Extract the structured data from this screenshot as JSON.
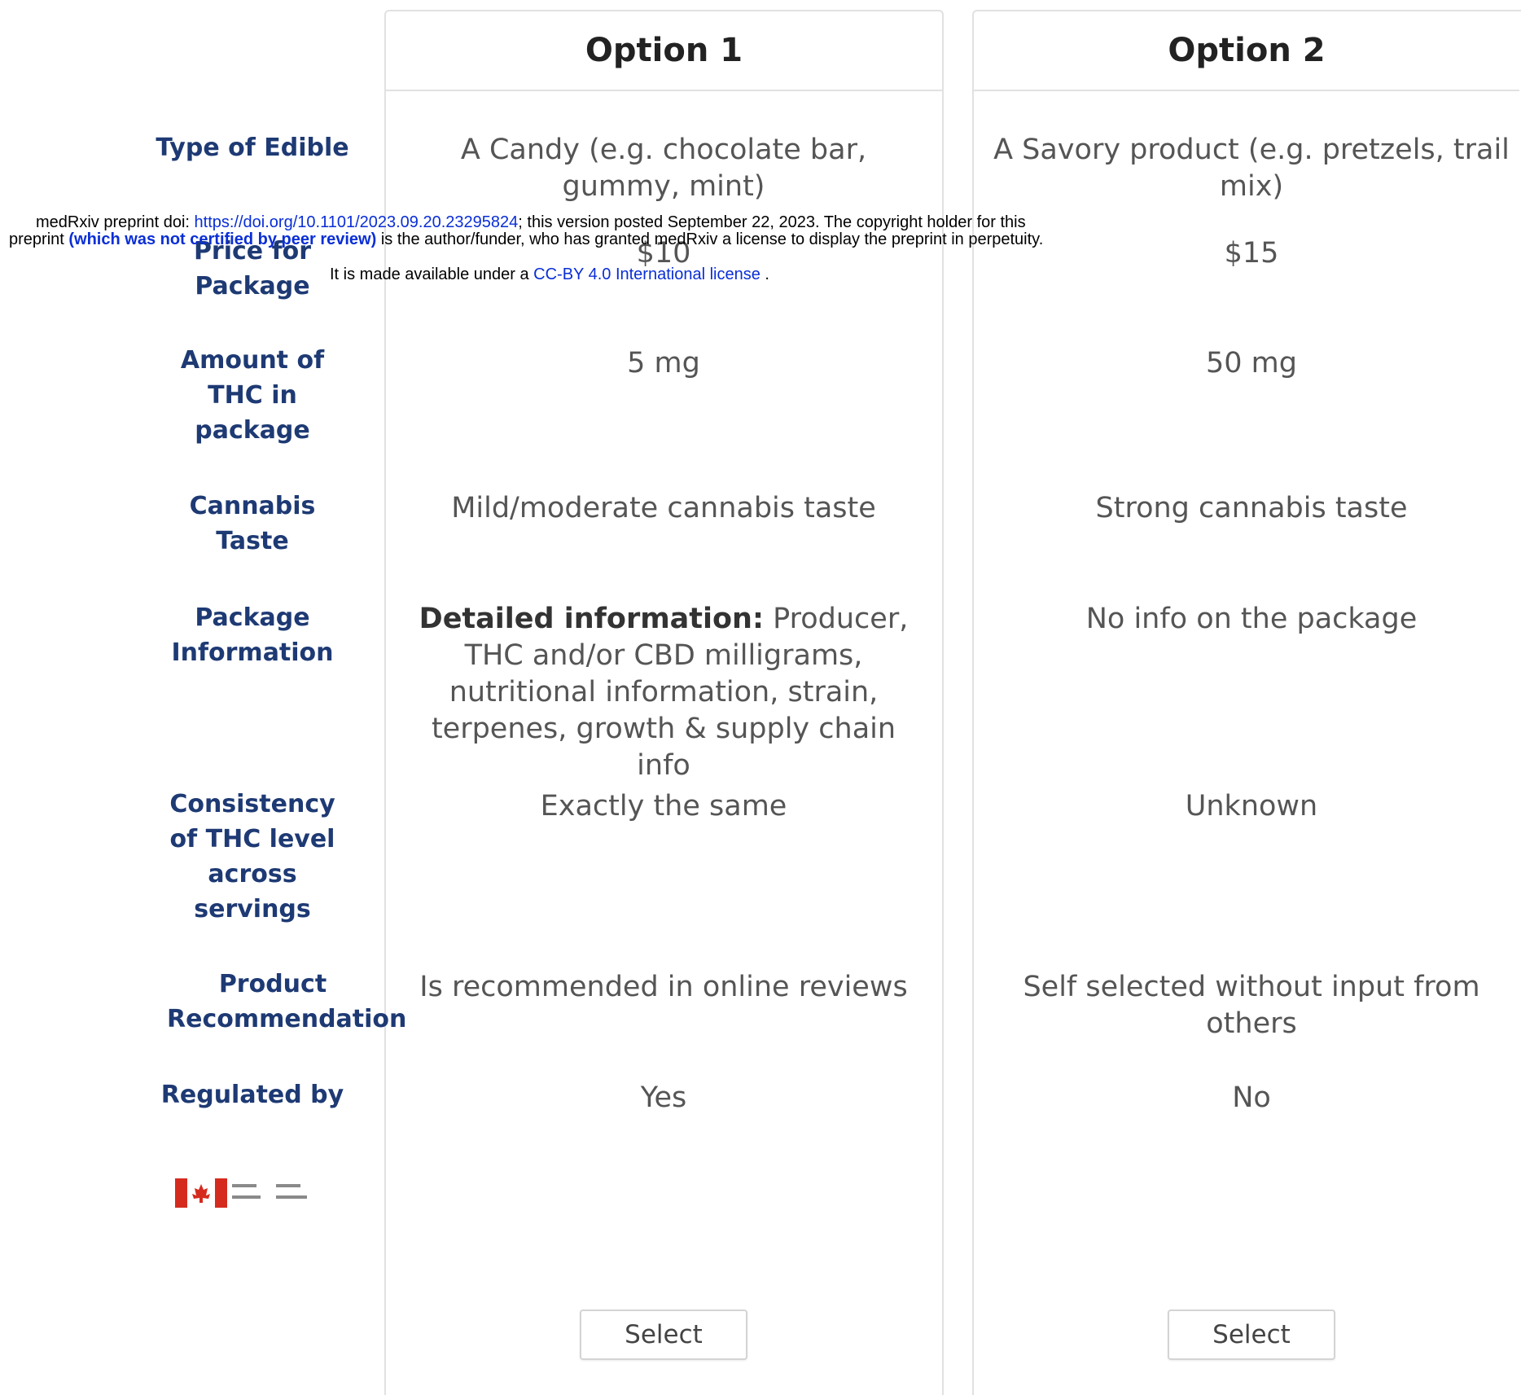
{
  "options": [
    {
      "title": "Option 1",
      "select_label": "Select"
    },
    {
      "title": "Option 2",
      "select_label": "Select"
    }
  ],
  "attributes": [
    {
      "label": "Type of Edible",
      "option1": "A Candy (e.g. chocolate bar, gummy, mint)",
      "option2": "A Savory product (e.g. pretzels, trail mix)"
    },
    {
      "label": "Price for Package",
      "option1": "$10",
      "option2": "$15"
    },
    {
      "label": "Amount of THC in package",
      "option1": "5 mg",
      "option2": "50 mg"
    },
    {
      "label": "Cannabis Taste",
      "option1": "Mild/moderate cannabis taste",
      "option2": "Strong cannabis taste"
    },
    {
      "label": "Package Information",
      "option1_bold": "Detailed information:",
      "option1": "Producer, THC and/or CBD milligrams, nutritional information, strain, terpenes, growth & supply chain info",
      "option2": "No info on the package"
    },
    {
      "label": "Consistency of THC level across servings",
      "option1": "Exactly the same",
      "option2": "Unknown"
    },
    {
      "label": "Product Recommendation",
      "option1": "Is recommended in online reviews",
      "option2": "Self selected without input from others"
    },
    {
      "label": "Regulated by",
      "option1": "Yes",
      "option2": "No"
    }
  ],
  "logo": {
    "text_en": "Health Canada",
    "text_fr": "Santé Canada",
    "flag_red": "#d52b1e"
  },
  "preprint_notice": {
    "line1_prefix": "medRxiv preprint doi: ",
    "doi_link": "https://doi.org/10.1101/2023.09.20.23295824",
    "line1_suffix": "; this version posted September 22, 2023. The copyright holder for this",
    "line2_prefix": "preprint ",
    "line2_bold": "(which was not certified by peer review)",
    "line2_suffix": " is the author/funder, who has granted medRxiv a license to display the preprint in perpetuity.",
    "line3_prefix": "It is made available under a ",
    "license_link": "CC-BY 4.0 International license",
    "line3_suffix": " ."
  },
  "colors": {
    "label_blue": "#1e3a74",
    "cell_gray": "#555555",
    "border": "#e1e1e1",
    "link_blue": "#0a2ed6"
  }
}
